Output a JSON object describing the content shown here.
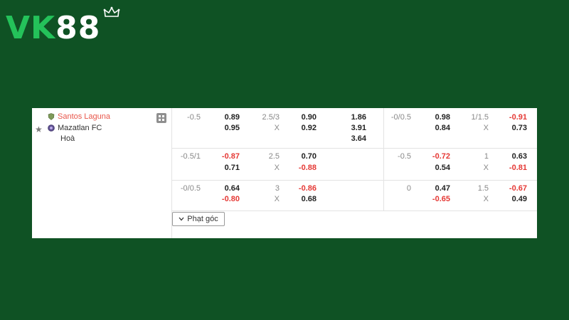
{
  "logo": {
    "part1": "VK",
    "part2": "88"
  },
  "match": {
    "home_team": "Santos Laguna",
    "away_team": "Mazatlan FC",
    "draw_label": "Hoà"
  },
  "rows": [
    {
      "ft_hdp_line": "-0.5",
      "ft_hdp_home": "0.89",
      "ft_hdp_away": "0.95",
      "ft_ou_line": "2.5/3",
      "ft_ou_over": "0.90",
      "ft_ou_under_label": "X",
      "ft_ou_under": "0.92",
      "ft_1x2_home": "1.86",
      "ft_1x2_away": "3.91",
      "ft_1x2_draw": "3.64",
      "h1_hdp_line": "-0/0.5",
      "h1_hdp_home": "0.98",
      "h1_hdp_away": "0.84",
      "h1_ou_line": "1/1.5",
      "h1_ou_over": "-0.91",
      "h1_ou_under_label": "X",
      "h1_ou_under": "0.73"
    },
    {
      "ft_hdp_line": "-0.5/1",
      "ft_hdp_home": "-0.87",
      "ft_hdp_away": "0.71",
      "ft_ou_line": "2.5",
      "ft_ou_over": "0.70",
      "ft_ou_under_label": "X",
      "ft_ou_under": "-0.88",
      "h1_hdp_line": "-0.5",
      "h1_hdp_home": "-0.72",
      "h1_hdp_away": "0.54",
      "h1_ou_line": "1",
      "h1_ou_over": "0.63",
      "h1_ou_under_label": "X",
      "h1_ou_under": "-0.81"
    },
    {
      "ft_hdp_line": "-0/0.5",
      "ft_hdp_home": "0.64",
      "ft_hdp_away": "-0.80",
      "ft_ou_line": "3",
      "ft_ou_over": "-0.86",
      "ft_ou_under_label": "X",
      "ft_ou_under": "0.68",
      "h1_hdp_line": "0",
      "h1_hdp_home": "0.47",
      "h1_hdp_away": "-0.65",
      "h1_ou_line": "1.5",
      "h1_ou_over": "-0.67",
      "h1_ou_under_label": "X",
      "h1_ou_under": "0.49"
    }
  ],
  "corner_button": {
    "label": "Phạt góc"
  },
  "colors": {
    "background": "#0f5224",
    "brand_green": "#24c25a",
    "negative_odd": "#e53935",
    "home_team": "#e8564a"
  },
  "icons": [
    "crown-icon",
    "star-icon",
    "team-badge-icon",
    "stats-icon",
    "chevron-down-icon"
  ]
}
